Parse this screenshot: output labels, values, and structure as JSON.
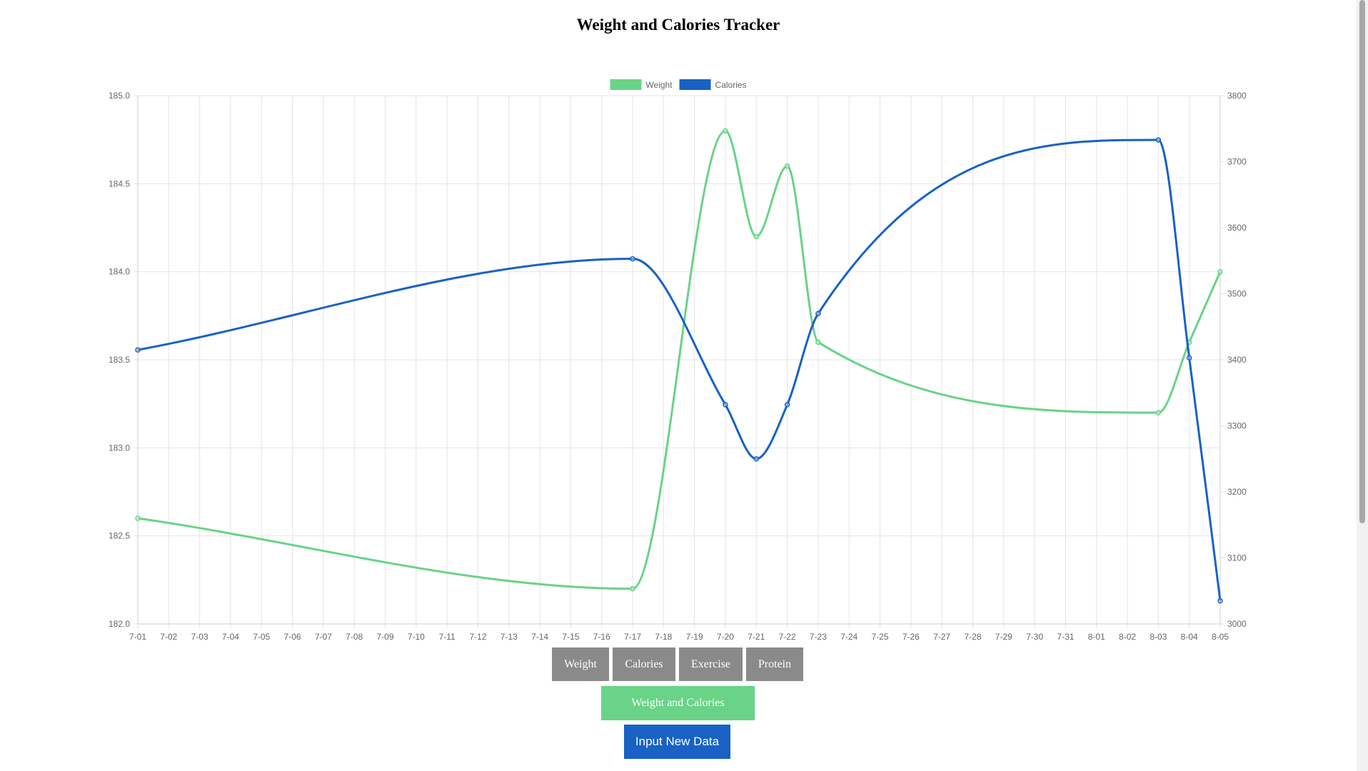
{
  "header": {
    "title": "Weight and Calories Tracker"
  },
  "buttons": {
    "weight": "Weight",
    "calories": "Calories",
    "exercise": "Exercise",
    "protein": "Protein",
    "weight_and_calories": "Weight and Calories",
    "input_new_data": "Input New Data"
  },
  "colors": {
    "weight": "#69d387",
    "calories": "#1762c4",
    "gray_button": "#8a8a8a"
  },
  "chart_data": {
    "type": "line",
    "x": [
      "7-01",
      "7-02",
      "7-03",
      "7-04",
      "7-05",
      "7-06",
      "7-07",
      "7-08",
      "7-09",
      "7-10",
      "7-11",
      "7-12",
      "7-13",
      "7-14",
      "7-15",
      "7-16",
      "7-17",
      "7-18",
      "7-19",
      "7-20",
      "7-21",
      "7-22",
      "7-23",
      "7-24",
      "7-25",
      "7-26",
      "7-27",
      "7-28",
      "7-29",
      "7-30",
      "7-31",
      "8-01",
      "8-02",
      "8-03",
      "8-04",
      "8-05"
    ],
    "legend": [
      "Weight",
      "Calories"
    ],
    "legend_position": "top-center",
    "grid": true,
    "series": [
      {
        "name": "Weight",
        "axis": "left",
        "color": "#69d387",
        "points": [
          {
            "x": "7-01",
            "y": 182.6
          },
          {
            "x": "7-17",
            "y": 182.2
          },
          {
            "x": "7-20",
            "y": 184.8
          },
          {
            "x": "7-21",
            "y": 184.2
          },
          {
            "x": "7-22",
            "y": 184.6
          },
          {
            "x": "7-23",
            "y": 183.6
          },
          {
            "x": "8-03",
            "y": 183.2
          },
          {
            "x": "8-04",
            "y": 183.6
          },
          {
            "x": "8-05",
            "y": 184.0
          }
        ]
      },
      {
        "name": "Calories",
        "axis": "right",
        "color": "#1762c4",
        "points": [
          {
            "x": "7-01",
            "y": 3415
          },
          {
            "x": "7-17",
            "y": 3553
          },
          {
            "x": "7-20",
            "y": 3332
          },
          {
            "x": "7-21",
            "y": 3250
          },
          {
            "x": "7-22",
            "y": 3332
          },
          {
            "x": "7-23",
            "y": 3470
          },
          {
            "x": "8-03",
            "y": 3733
          },
          {
            "x": "8-04",
            "y": 3403
          },
          {
            "x": "8-05",
            "y": 3035
          }
        ]
      }
    ],
    "y_left": {
      "range": [
        182.0,
        185.0
      ],
      "ticks": [
        "182.0",
        "182.5",
        "183.0",
        "183.5",
        "184.0",
        "184.5",
        "185.0"
      ]
    },
    "y_right": {
      "range": [
        3000,
        3800
      ],
      "ticks": [
        "3000",
        "3100",
        "3200",
        "3300",
        "3400",
        "3500",
        "3600",
        "3700",
        "3800"
      ]
    }
  }
}
